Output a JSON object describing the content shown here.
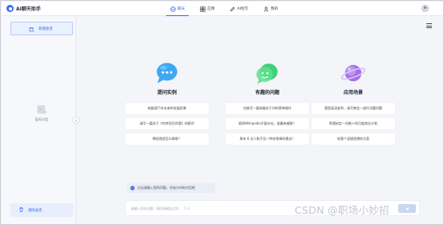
{
  "app": {
    "name": "AI聊天助手"
  },
  "nav": {
    "items": [
      {
        "label": "聊天",
        "icon": "chat-icon",
        "active": true
      },
      {
        "label": "应用",
        "icon": "grid-icon",
        "active": false
      },
      {
        "label": "AI绘写",
        "icon": "pen-icon",
        "active": false
      },
      {
        "label": "我的",
        "icon": "user-icon",
        "active": false
      }
    ]
  },
  "sidebar": {
    "new_chat_label": "新建会话",
    "empty_text": "暂无对话",
    "clear_label": "清除会话"
  },
  "columns": [
    {
      "title": "提问实例",
      "icon": "chat-bubble-icon",
      "color": "#3fa8f5",
      "prompts": [
        "新能源汽车未来的发展前景",
        "请写一篇关于《何幸而生的我》的影评",
        "降低焦虑怎么做呢？"
      ]
    },
    {
      "title": "有趣的问题",
      "icon": "smile-bubble-icon",
      "color": "#3fcf7a",
      "prompts": [
        "包装写一篇有趣关于UI的简单操作",
        "假如Wikipedia不复存在，谁最有威胁？",
        "周末 6 点人和不及一种非常棒的建议？"
      ]
    },
    {
      "title": "应用场景",
      "icon": "planet-icon",
      "color": "#a470e6",
      "prompts": [
        "我是英语老师，请写做会一道坏试题问题",
        "帮我拟定一份推十的月度商业计划",
        "给我个读操思想的方案"
      ]
    }
  ],
  "notice": {
    "text": "点击请输入您的问题，开始与AI的对话吧"
  },
  "input": {
    "placeholder": "请输入您的问题（调用请输出点4）、1 0"
  },
  "watermark": "CSDN @职场小妙招",
  "colors": {
    "accent": "#2f67e8",
    "background": "#f3f5f9"
  }
}
